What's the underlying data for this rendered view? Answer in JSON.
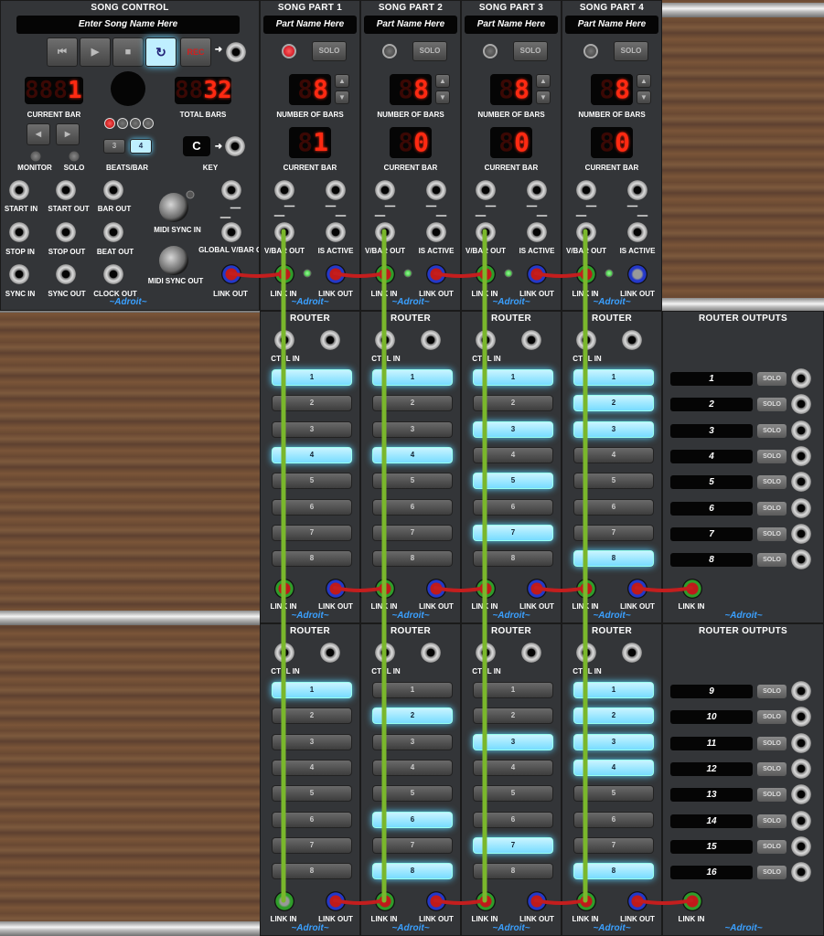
{
  "song_control": {
    "title": "SONG CONTROL",
    "song_name": "Enter Song Name Here",
    "transport": {
      "rec": "REC"
    },
    "current_bar": {
      "label": "CURRENT BAR",
      "value": "1"
    },
    "total_bars": {
      "label": "TOTAL BARS",
      "value": "32"
    },
    "monitor": "MONITOR",
    "solo": "SOLO",
    "beats_per_bar": {
      "label": "BEATS/BAR",
      "options": [
        "3",
        "4"
      ],
      "selected": "4"
    },
    "key": {
      "label": "KEY",
      "value": "C"
    },
    "jacks": {
      "start_in": "START IN",
      "start_out": "START OUT",
      "bar_out": "BAR OUT",
      "stop_in": "STOP IN",
      "stop_out": "STOP OUT",
      "beat_out": "BEAT OUT",
      "sync_in": "SYNC IN",
      "sync_out": "SYNC OUT",
      "clock_out": "CLOCK OUT",
      "midi_sync_in": "MIDI SYNC IN",
      "midi_sync_out": "MIDI SYNC OUT",
      "global_vbar_out": "GLOBAL V/BAR OUT",
      "link_out": "LINK OUT"
    },
    "brand": "~Adroit~"
  },
  "song_parts": [
    {
      "title": "SONG PART 1",
      "name": "Part Name Here",
      "solo": "SOLO",
      "number_of_bars": "8",
      "current_bar": "1"
    },
    {
      "title": "SONG PART 2",
      "name": "Part Name Here",
      "solo": "SOLO",
      "number_of_bars": "8",
      "current_bar": "0"
    },
    {
      "title": "SONG PART 3",
      "name": "Part Name Here",
      "solo": "SOLO",
      "number_of_bars": "8",
      "current_bar": "0"
    },
    {
      "title": "SONG PART 4",
      "name": "Part Name Here",
      "solo": "SOLO",
      "number_of_bars": "8",
      "current_bar": "0"
    }
  ],
  "part_labels": {
    "number_of_bars": "NUMBER OF BARS",
    "current_bar": "CURRENT BAR",
    "vbar_out": "V/BAR OUT",
    "is_active": "IS ACTIVE",
    "link_in": "LINK IN",
    "link_out": "LINK OUT",
    "brand": "~Adroit~"
  },
  "router_labels": {
    "title": "ROUTER",
    "ctrl_in": "CTRL IN",
    "link_in": "LINK IN",
    "link_out": "LINK OUT",
    "brand": "~Adroit~",
    "outputs_title": "ROUTER OUTPUTS",
    "solo": "SOLO"
  },
  "router_rows": [
    [
      {
        "rows": [
          "1",
          "2",
          "3",
          "4",
          "5",
          "6",
          "7",
          "8"
        ],
        "active": [
          1,
          0,
          0,
          1,
          0,
          0,
          0,
          0
        ]
      },
      {
        "rows": [
          "1",
          "2",
          "3",
          "4",
          "5",
          "6",
          "7",
          "8"
        ],
        "active": [
          1,
          0,
          0,
          1,
          0,
          0,
          0,
          0
        ]
      },
      {
        "rows": [
          "1",
          "2",
          "3",
          "4",
          "5",
          "6",
          "7",
          "8"
        ],
        "active": [
          1,
          0,
          1,
          0,
          1,
          0,
          1,
          0
        ]
      },
      {
        "rows": [
          "1",
          "2",
          "3",
          "4",
          "5",
          "6",
          "7",
          "8"
        ],
        "active": [
          1,
          1,
          1,
          0,
          0,
          0,
          0,
          1
        ]
      }
    ],
    [
      {
        "rows": [
          "1",
          "2",
          "3",
          "4",
          "5",
          "6",
          "7",
          "8"
        ],
        "active": [
          1,
          0,
          0,
          0,
          0,
          0,
          0,
          0
        ]
      },
      {
        "rows": [
          "1",
          "2",
          "3",
          "4",
          "5",
          "6",
          "7",
          "8"
        ],
        "active": [
          0,
          1,
          0,
          0,
          0,
          1,
          0,
          1
        ]
      },
      {
        "rows": [
          "1",
          "2",
          "3",
          "4",
          "5",
          "6",
          "7",
          "8"
        ],
        "active": [
          0,
          0,
          1,
          0,
          0,
          0,
          1,
          0
        ]
      },
      {
        "rows": [
          "1",
          "2",
          "3",
          "4",
          "5",
          "6",
          "7",
          "8"
        ],
        "active": [
          1,
          1,
          1,
          1,
          0,
          0,
          0,
          1
        ]
      }
    ]
  ],
  "router_outputs": [
    [
      "1",
      "2",
      "3",
      "4",
      "5",
      "6",
      "7",
      "8"
    ],
    [
      "9",
      "10",
      "11",
      "12",
      "13",
      "14",
      "15",
      "16"
    ]
  ],
  "colors": {
    "panel": "#333538",
    "led_red": "#ff2a12",
    "active_blue": "#4fcfff",
    "cable_green": "#7ab72c",
    "cable_red": "#c41e1e",
    "brand_blue": "#3aa0ff"
  }
}
